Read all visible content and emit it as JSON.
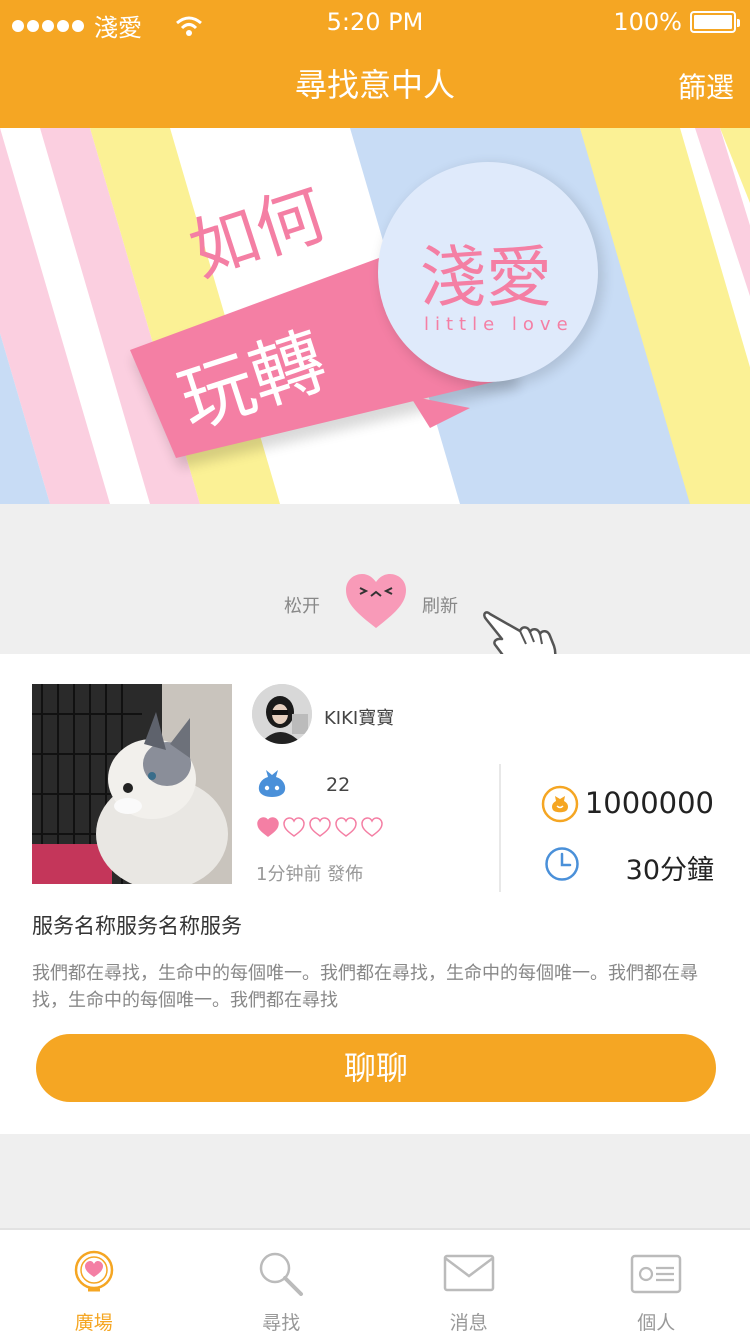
{
  "status_bar": {
    "carrier": "淺愛",
    "time": "5:20 PM",
    "battery": "100%"
  },
  "header": {
    "title": "尋找意中人",
    "filter_label": "篩選"
  },
  "banner": {
    "line1": "如何",
    "line2": "玩轉",
    "logo_cn": "淺愛",
    "logo_en": "little love"
  },
  "pull_refresh": {
    "left_text": "松开",
    "right_text": "刷新"
  },
  "card": {
    "username": "KIKI寶寶",
    "count": "22",
    "rating": 1,
    "rating_max": 5,
    "posted": "1分钟前 發佈",
    "coins": "1000000",
    "duration": "30分鐘",
    "service_name": "服务名称服务名称服务",
    "service_desc": "我們都在尋找，生命中的每個唯一。我們都在尋找，生命中的每個唯一。我們都在尋找，生命中的每個唯一。我們都在尋找",
    "chat_label": "聊聊"
  },
  "tabs": [
    {
      "label": "廣場",
      "icon": "plaza-heart-icon",
      "active": true
    },
    {
      "label": "尋找",
      "icon": "search-icon",
      "active": false
    },
    {
      "label": "消息",
      "icon": "mail-icon",
      "active": false
    },
    {
      "label": "個人",
      "icon": "id-card-icon",
      "active": false
    }
  ],
  "colors": {
    "accent": "#f5a623",
    "pink": "#f47fa4",
    "blue": "#4a90d9"
  }
}
